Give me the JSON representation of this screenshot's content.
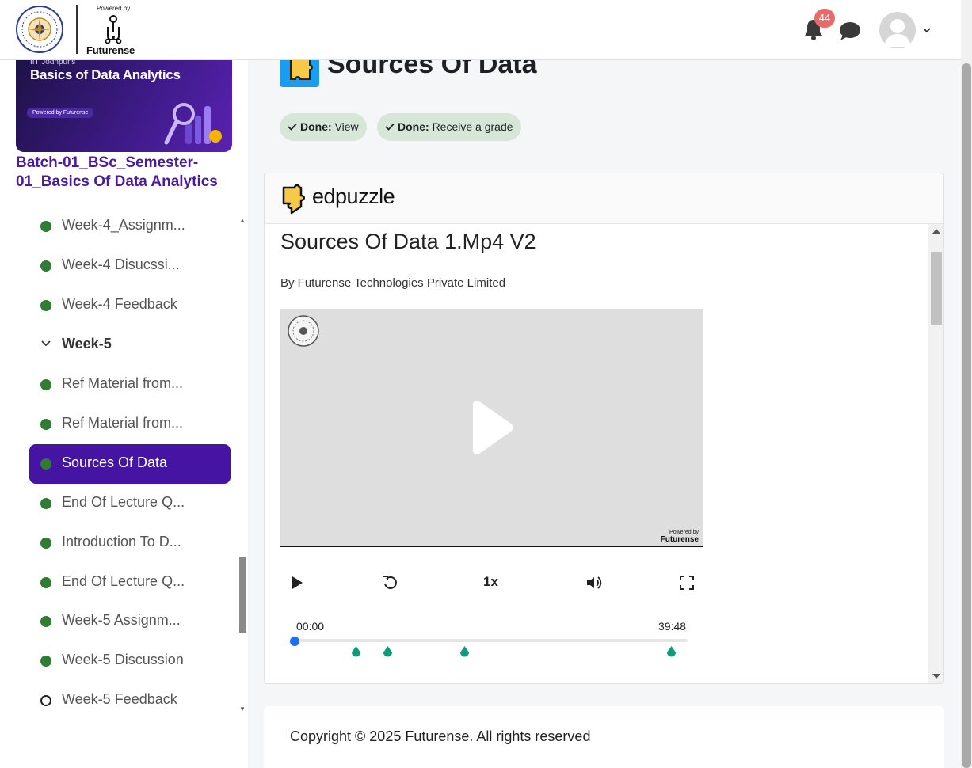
{
  "header": {
    "powered_by": "Powered by",
    "brand": "Futurense",
    "notification_count": "44"
  },
  "sidebar": {
    "banner_subtitle": "IIT Jodhpur's",
    "banner_title": "Basics of Data Analytics",
    "banner_pill": "Powered by Futurense",
    "course_name": "Batch-01_BSc_Semester-01_Basics Of Data Analytics",
    "items": [
      {
        "label": "Week-4_Assignm...",
        "status": "done"
      },
      {
        "label": "Week-4 Disucssi...",
        "status": "done"
      },
      {
        "label": "Week-4 Feedback",
        "status": "done"
      },
      {
        "label": "Week-5",
        "status": "section"
      },
      {
        "label": "Ref Material from...",
        "status": "done"
      },
      {
        "label": "Ref Material from...",
        "status": "done"
      },
      {
        "label": "Sources Of Data",
        "status": "done",
        "active": true
      },
      {
        "label": "End Of Lecture Q...",
        "status": "done"
      },
      {
        "label": "Introduction To D...",
        "status": "done"
      },
      {
        "label": "End Of Lecture Q...",
        "status": "done"
      },
      {
        "label": "Week-5 Assignm...",
        "status": "done"
      },
      {
        "label": "Week-5 Discussion",
        "status": "done"
      },
      {
        "label": "Week-5 Feedback",
        "status": "todo"
      }
    ]
  },
  "main": {
    "title": "Sources Of Data",
    "completion": [
      {
        "done": "Done:",
        "label": "View"
      },
      {
        "done": "Done:",
        "label": "Receive a grade"
      }
    ],
    "edpuzzle_brand": "edpuzzle",
    "video_title": "Sources Of Data 1.Mp4 V2",
    "video_by": "By Futurense Technologies Private Limited",
    "player_powered": "Powered by",
    "player_brand": "Futurense",
    "speed": "1x",
    "time_current": "00:00",
    "time_total": "39:48",
    "progress": 0
  },
  "footer": {
    "copyright": "Copyright © 2025 Futurense. All rights reserved"
  },
  "colors": {
    "accent": "#4514a3",
    "done_dot": "#2e7d32",
    "badge": "#ea6a6a",
    "question_marker": "#0f9b7a",
    "progress_knob": "#1d6ef0"
  }
}
